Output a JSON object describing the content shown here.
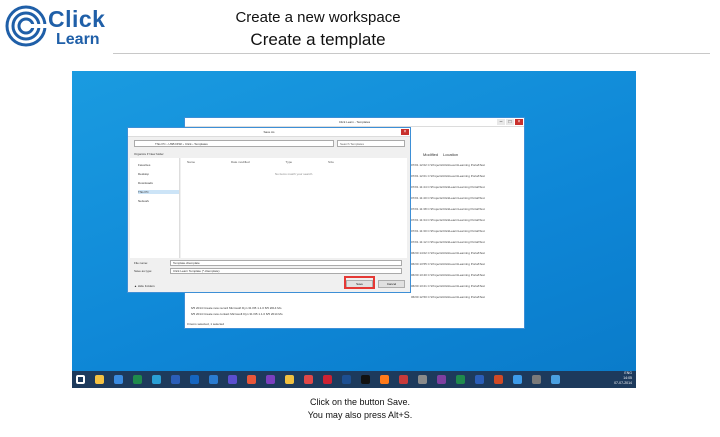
{
  "logo": {
    "line1": "Click",
    "line2": "Learn"
  },
  "header": {
    "title": "Create a new workspace",
    "subtitle": "Create a template"
  },
  "save_dialog": {
    "title": "Save As",
    "address": "This PC › USB DISK › Click › Templates",
    "search_placeholder": "Search Templates",
    "organize": "Organize ▾   New folder",
    "nav_items": [
      "Favorites",
      "Desktop",
      "Downloads",
      "This PC",
      "Network"
    ],
    "columns": [
      "Name",
      "Date modified",
      "Type",
      "Size"
    ],
    "empty_text": "No items match your search.",
    "filename_label": "File name:",
    "filename_value": "Template.cltemplate",
    "type_label": "Save as type:",
    "type_value": "Click Learn Template (*.cltemplate)",
    "hide_folders": "▲ Hide Folders",
    "save_label": "Save",
    "cancel_label": "Cancel"
  },
  "back_window": {
    "title": "Click Learn - Templates",
    "column_1": "Modified",
    "column_2": "Location",
    "rows": [
      "07/01 12:02  C:\\Projects\\ClickLearn\\Learning Portal\\Test",
      "07/01 12:01  C:\\Projects\\ClickLearn\\Learning Portal\\Test",
      "07/01 11:44  C:\\Projects\\ClickLearn\\Learning Portal\\Test",
      "07/01 11:40  C:\\Projects\\ClickLearn\\Learning Portal\\Test",
      "07/01 11:38  C:\\Projects\\ClickLearn\\Learning Portal\\Test",
      "07/01 11:34  C:\\Projects\\ClickLearn\\Learning Portal\\Test",
      "07/01 11:30  C:\\Projects\\ClickLearn\\Learning Portal\\Test",
      "07/01 11:12  C:\\Projects\\ClickLearn\\Learning Portal\\Test",
      "06/30 14:02  C:\\Projects\\ClickLearn\\Learning Portal\\Test",
      "06/30 13:55  C:\\Projects\\ClickLearn\\Learning Portal\\Test",
      "06/30 13:40  C:\\Projects\\ClickLearn\\Learning Portal\\Test",
      "06/30 13:21  C:\\Projects\\ClickLearn\\Learning Portal\\Test",
      "06/30 12:50  C:\\Projects\\ClickLearn\\Learning Portal\\Test"
    ],
    "lower_rows": [
      "6/5 2014 Create new record     Microsoft Dyn     31 KB   1.1.0  6/5 2014 Mo",
      "6/5 2014 Create new contact    Microsoft Dyn     31 KB   1.1.0  6/5 2014 Mo"
    ],
    "status": "0 items selected, 1 selected"
  },
  "taskbar": {
    "icons": [
      "start",
      "explorer",
      "ie",
      "excel",
      "store",
      "word",
      "outlook",
      "lync",
      "ax",
      "paint",
      "vs",
      "folder",
      "chrome",
      "app",
      "powershell",
      "cmd",
      "firefox",
      "app2",
      "snip",
      "onenote",
      "excel2",
      "word2",
      "ppt",
      "app3",
      "app4",
      "app5"
    ],
    "time": "14:05",
    "date": "07-07-2014",
    "lang": "ENG"
  },
  "caption": {
    "line1": "Click on the button Save.",
    "line2": "You may also press Alt+S."
  },
  "colors": {
    "desktop": "#0e86d6",
    "taskbar": "#1d3a5c",
    "highlight": "#e53935",
    "logo": "#1f5fa8"
  }
}
